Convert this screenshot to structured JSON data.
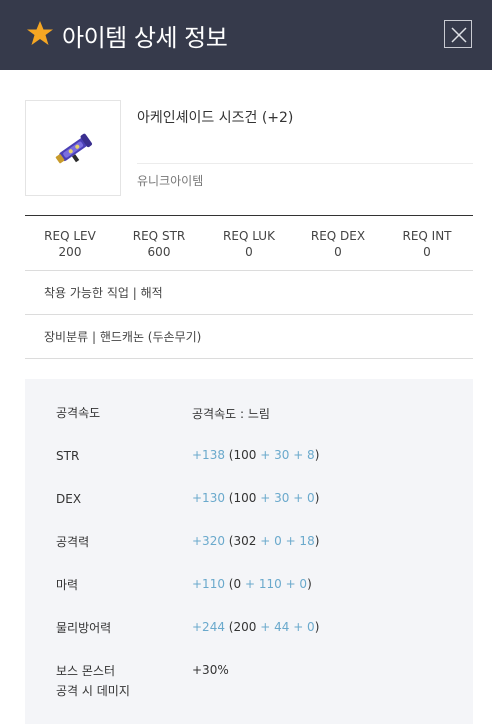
{
  "header": {
    "title": "아이템 상세 정보",
    "accent": "#f5a623"
  },
  "item": {
    "name": "아케인셰이드 시즈건 (+2)",
    "grade": "유니크아이템",
    "icon": "siege-gun-icon"
  },
  "requirements": [
    {
      "label": "REQ LEV",
      "value": "200"
    },
    {
      "label": "REQ STR",
      "value": "600"
    },
    {
      "label": "REQ LUK",
      "value": "0"
    },
    {
      "label": "REQ DEX",
      "value": "0"
    },
    {
      "label": "REQ INT",
      "value": "0"
    }
  ],
  "info": {
    "job": "착용 가능한 직업 | 해적",
    "category": "장비분류 | 핸드캐논 (두손무기)"
  },
  "stats": {
    "speed": {
      "label": "공격속도",
      "value": "공격속도 : 느림"
    },
    "str": {
      "label": "STR",
      "total": "+138",
      "base": "(100",
      "plus1": "+ 30",
      "plus2": "+ 8",
      "close": ")"
    },
    "dex": {
      "label": "DEX",
      "total": "+130",
      "base": "(100",
      "plus1": "+ 30",
      "plus2": "+ 0",
      "close": ")"
    },
    "atk": {
      "label": "공격력",
      "total": "+320",
      "base": "(302",
      "plus1": "+ 0",
      "plus2": "+ 18",
      "close": ")"
    },
    "mag": {
      "label": "마력",
      "total": "+110",
      "base": "(0",
      "plus1": "+ 110",
      "plus2": "+ 0",
      "close": ")"
    },
    "def": {
      "label": "물리방어력",
      "total": "+244",
      "base": "(200",
      "plus1": "+ 44",
      "plus2": "+ 0",
      "close": ")"
    },
    "boss": {
      "label_line1": "보스 몬스터",
      "label_line2": "공격 시 데미지",
      "value": "+30%"
    }
  },
  "colors": {
    "header_bg": "#363a4b",
    "bonus": "#6aa9cc",
    "panel_bg": "#f4f5f8"
  }
}
